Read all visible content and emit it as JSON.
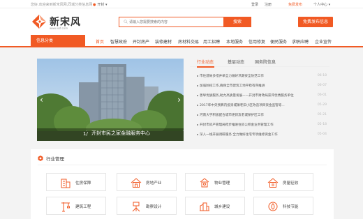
{
  "topbar": {
    "welcome": "您好,欢迎来到新宋风网,同城分类信息网",
    "city": "开封",
    "login": "登录",
    "register": "注册",
    "publish_link": "免费发布",
    "user_center": "个人中心"
  },
  "header": {
    "logo_text": "新宋风",
    "logo_sub": "www.xsf.com",
    "search_placeholder": "请输入您需要搜索的内容",
    "search_button": "搜索",
    "publish_button": "免费发布信息"
  },
  "nav": {
    "category_button": "信息分类",
    "items": [
      {
        "label": "首页",
        "active": true
      },
      {
        "label": "智慧政府",
        "active": false
      },
      {
        "label": "开封房产",
        "active": false
      },
      {
        "label": "装修建材",
        "active": false
      },
      {
        "label": "房材料交易",
        "active": false
      },
      {
        "label": "用工招聘",
        "active": false
      },
      {
        "label": "本地服务",
        "active": false
      },
      {
        "label": "信用修复",
        "active": false
      },
      {
        "label": "便民服务",
        "active": false
      },
      {
        "label": "求职应聘",
        "active": false
      },
      {
        "label": "企业宣传",
        "active": false
      }
    ]
  },
  "banner": {
    "index": "1/",
    "caption": "开封市民之家金融服务中心"
  },
  "news": {
    "tabs": [
      "行业动态",
      "基层动态",
      "国务院信息"
    ],
    "items": [
      {
        "title": "市住建局多措并举全力做好汛期安全防范工作",
        "date": "06-18"
      },
      {
        "title": "加强防控工作,确保全市建筑工地平稳有序推进",
        "date": "06-07"
      },
      {
        "title": "善导优质服务,助力高质量发展——开封市财政局获评优秀服务单位",
        "date": "06-01"
      },
      {
        "title": "2017年中央预算内投资城镇老旧小区改造项目资金监管等...",
        "date": "05-29"
      },
      {
        "title": "河南大学积极配合城市更新及老城保护区工作",
        "date": "05-21"
      },
      {
        "title": "开封市房产管理局稳步推进住房公积金业务管理工作",
        "date": "05-18"
      },
      {
        "title": "深入一线开展调研服务 全力做好住宅专项维修资金工作",
        "date": "05-04"
      }
    ]
  },
  "industry": {
    "title": "行业管理",
    "cards": [
      {
        "label": "住房保障",
        "icon": "building-icon"
      },
      {
        "label": "房地产业",
        "icon": "house-icon"
      },
      {
        "label": "物业管理",
        "icon": "property-icon"
      },
      {
        "label": "房屋征收",
        "icon": "home-icon"
      },
      {
        "label": "建筑工程",
        "icon": "crane-icon"
      },
      {
        "label": "勘察设计",
        "icon": "survey-icon"
      },
      {
        "label": "城乡建设",
        "icon": "city-icon"
      },
      {
        "label": "科技节能",
        "icon": "energy-icon"
      }
    ]
  },
  "colors": {
    "accent": "#f15a24"
  }
}
